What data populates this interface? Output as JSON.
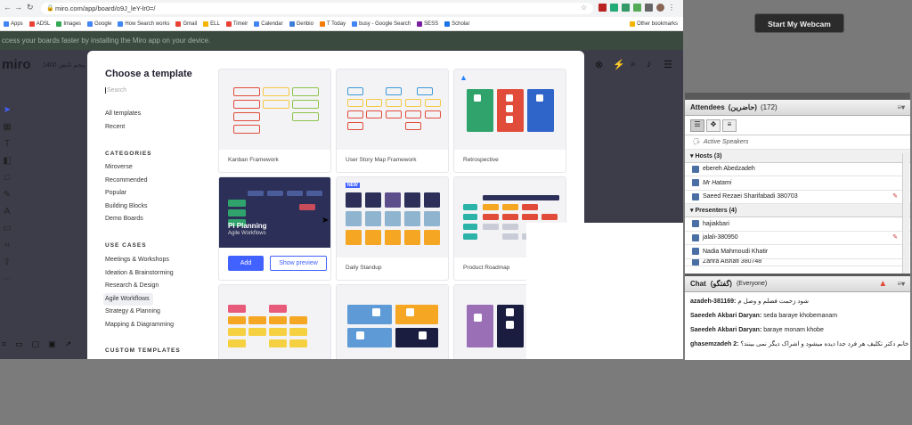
{
  "browser": {
    "url": "miro.com/app/board/o9J_leY-lr0=/",
    "bookmarks": [
      "Apps",
      "ADSL",
      "Images",
      "Google",
      "How Search works",
      "Gmail",
      "ELL",
      "Timeir",
      "Calendar",
      "Genbio",
      "T Today",
      "busy - Google Search",
      "SESS",
      "Scholar",
      "Other bookmarks"
    ]
  },
  "banner": "ccess your boards faster by installing the Miro app on your device.",
  "miro": {
    "logo": "miro",
    "board_title": "جلسه پنجم تابش 1400"
  },
  "modal": {
    "title": "Choose a template",
    "search_placeholder": "Search",
    "nav": [
      "All templates",
      "Recent"
    ],
    "categories_heading": "CATEGORIES",
    "categories": [
      "Miroverse",
      "Recommended",
      "Popular",
      "Building Blocks",
      "Demo Boards"
    ],
    "usecases_heading": "USE CASES",
    "usecases": [
      "Meetings & Workshops",
      "Ideation & Brainstorming",
      "Research & Design",
      "Agile Workflows",
      "Strategy & Planning",
      "Mapping & Diagramming"
    ],
    "custom_heading": "CUSTOM TEMPLATES",
    "cards": [
      {
        "name": "Kanban Framework"
      },
      {
        "name": "User Story Map Framework"
      },
      {
        "name": "Retrospective"
      },
      {
        "name": "PI Planning",
        "subtitle": "Agile Workflows",
        "add": "Add",
        "preview": "Show preview"
      },
      {
        "name": "Daily Standup",
        "badge": "NEW"
      },
      {
        "name": "Product Roadmap"
      }
    ]
  },
  "webcam": {
    "button": "Start My Webcam"
  },
  "attendees": {
    "title": "Attendees",
    "title_fa": "(حاضرین)",
    "count": "(172)",
    "active_speakers": "Active Speakers",
    "hosts_label": "Hosts (3)",
    "hosts": [
      "ebereh Abedzadeh",
      "Mr Hatami",
      "Saeed Rezaei Sharifabadi 380703"
    ],
    "presenters_label": "Presenters (4)",
    "presenters": [
      "hajiakbari",
      "jalali-380950",
      "Nadia Mahmoudi Khatir",
      "Zahra Alshafi 380748"
    ]
  },
  "chat": {
    "title": "Chat",
    "title_fa": "(گفتگو)",
    "scope": "(Everyone)",
    "messages": [
      {
        "user": "azadeh-381169:",
        "text": "شود زحمت فضلم و وصل م"
      },
      {
        "user": "Saeedeh Akbari Daryan:",
        "text": "seda baraye khobemanam"
      },
      {
        "user": "Saeedeh Akbari Daryan:",
        "text": "baraye monam khobe"
      },
      {
        "user": "ghasemzadeh 2:",
        "text": "خانم دکتر تکلیف هر فرد جدا دیده میشود و اشراک دیگر نمی بینند؟"
      }
    ]
  },
  "colors": {
    "accent": "#4262ff",
    "miro_dark": "#3d3d4a",
    "red": "#e14c3a"
  }
}
